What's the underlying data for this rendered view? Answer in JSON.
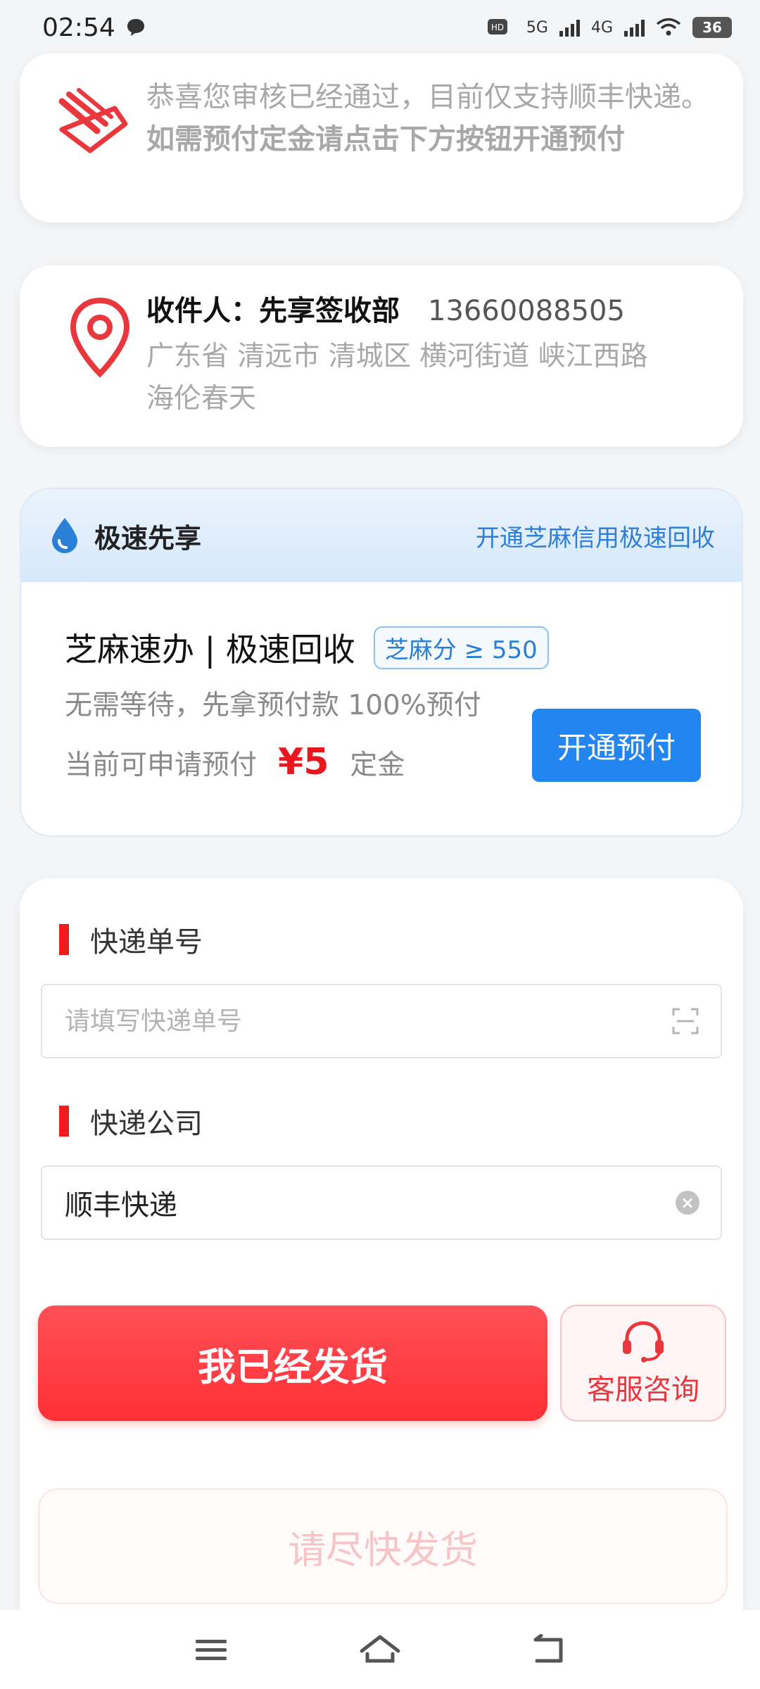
{
  "status_bar": {
    "time": "02:54",
    "network_1": "5G",
    "network_2": "4G",
    "battery": "36"
  },
  "notice": {
    "line1": "恭喜您审核已经通过，目前仅支持顺丰快递。",
    "line2": "如需预付定金请点击下方按钮开通预付"
  },
  "address": {
    "recipient": "收件人：先享签收部",
    "phone": "13660088505",
    "line1": "广东省 清远市 清城区 横河街道 峡江西路",
    "line2": "海伦春天"
  },
  "credit": {
    "title": "极速先享",
    "link": "开通芝麻信用极速回收",
    "name": "芝麻速办 | 极速回收",
    "badge": "芝麻分 ≥ 550",
    "desc": "无需等待，先拿预付款 100%预付",
    "label": "当前可申请预付",
    "amount": "¥5",
    "unit": "定金",
    "button": "开通预付"
  },
  "form": {
    "tracking_label": "快递单号",
    "tracking_placeholder": "请填写快递单号",
    "company_label": "快递公司",
    "company_value": "顺丰快递"
  },
  "actions": {
    "shipped": "我已经发货",
    "service": "客服咨询",
    "hurry": "请尽快发货"
  },
  "colors": {
    "accent_red": "#ff3a40",
    "accent_blue": "#2386f0"
  }
}
